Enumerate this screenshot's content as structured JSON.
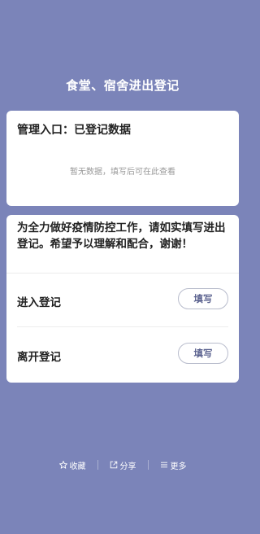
{
  "page": {
    "title": "食堂、宿舍进出登记"
  },
  "admin_card": {
    "header": "管理入口：已登记数据",
    "empty_hint": "暂无数据，填写后可在此查看"
  },
  "register_card": {
    "notice": "为全力做好疫情防控工作，请如实填写进出登记。希望予以理解和配合，谢谢！",
    "rows": [
      {
        "label": "进入登记",
        "button": "填写"
      },
      {
        "label": "离开登记",
        "button": "填写"
      }
    ]
  },
  "footer": {
    "items": [
      {
        "label": "收藏",
        "icon": "star-icon"
      },
      {
        "label": "分享",
        "icon": "share-icon"
      },
      {
        "label": "更多",
        "icon": "menu-icon"
      }
    ]
  },
  "colors": {
    "background": "#7b84b9",
    "card": "#ffffff",
    "button_text": "#5b628f"
  }
}
